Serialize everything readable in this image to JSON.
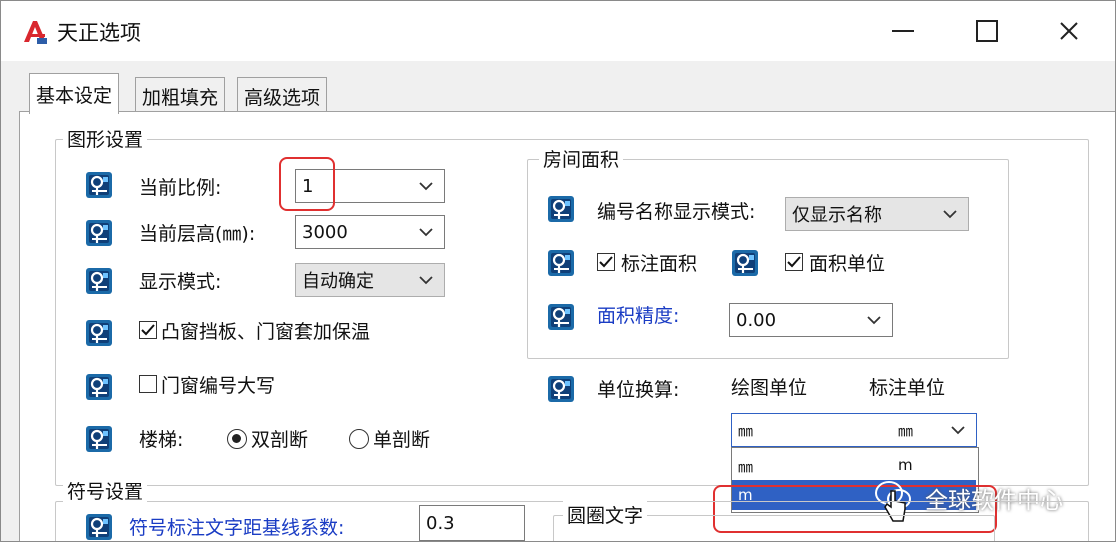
{
  "window": {
    "title": "天正选项"
  },
  "tabs": [
    {
      "label": "基本设定"
    },
    {
      "label": "加粗填充"
    },
    {
      "label": "高级选项"
    }
  ],
  "graphics": {
    "title": "图形设置",
    "scale_label": "当前比例:",
    "scale_value": "1",
    "height_label": "当前层高(㎜):",
    "height_value": "3000",
    "display_label": "显示模式:",
    "display_value": "自动确定",
    "bay_window_label": "凸窗挡板、门窗套加保温",
    "bay_window_checked": true,
    "door_upper_label": "门窗编号大写",
    "door_upper_checked": false,
    "stair_label": "楼梯:",
    "stair_options": [
      {
        "label": "双剖断",
        "selected": true
      },
      {
        "label": "单剖断",
        "selected": false
      }
    ]
  },
  "room_area": {
    "title": "房间面积",
    "display_mode_label": "编号名称显示模式:",
    "display_mode_value": "仅显示名称",
    "mark_area_label": "标注面积",
    "mark_area_checked": true,
    "area_unit_label": "面积单位",
    "area_unit_checked": true,
    "precision_label": "面积精度:",
    "precision_value": "0.00"
  },
  "unit_conversion": {
    "label": "单位换算:",
    "drawing_unit_label": "绘图单位",
    "mark_unit_label": "标注单位",
    "combo_left": "㎜",
    "combo_right": "㎜",
    "options": [
      "㎜",
      "m"
    ],
    "option_right_top": "m",
    "highlighted_option": 1
  },
  "symbols": {
    "title": "符号设置",
    "offset_label": "符号标注文字距基线系数:",
    "offset_value": "0.3",
    "circle_text_title": "圆圈文字"
  },
  "watermark": {
    "text": "全球软件中心"
  },
  "colors": {
    "accent": "#2f61c4",
    "highlight": "#e03030",
    "blue_text": "#1a3cc4"
  }
}
